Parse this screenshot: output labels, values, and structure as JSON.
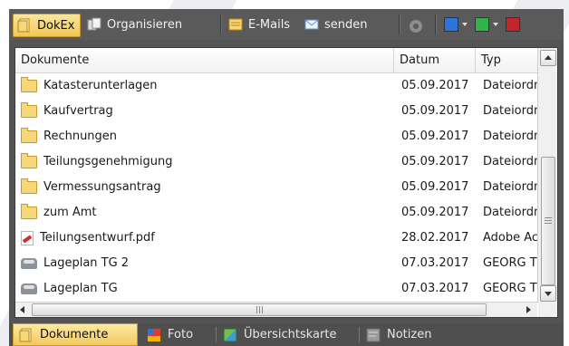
{
  "toolbar": {
    "dokex_label": "DokEx",
    "organisieren_label": "Organisieren",
    "emails_label": "E-Mails",
    "senden_label": "senden",
    "colors": {
      "blue": "#2b74d8",
      "green": "#34b24a",
      "red": "#c0262d"
    }
  },
  "list": {
    "columns": {
      "name": "Dokumente",
      "date": "Datum",
      "type": "Typ"
    },
    "rows": [
      {
        "icon": "folder-icon",
        "name": "Katasterunterlagen",
        "date": "05.09.2017",
        "type": "Dateiordner"
      },
      {
        "icon": "folder-icon",
        "name": "Kaufvertrag",
        "date": "05.09.2017",
        "type": "Dateiordner"
      },
      {
        "icon": "folder-icon",
        "name": "Rechnungen",
        "date": "05.09.2017",
        "type": "Dateiordner"
      },
      {
        "icon": "folder-icon",
        "name": "Teilungsgenehmigung",
        "date": "05.09.2017",
        "type": "Dateiordner"
      },
      {
        "icon": "folder-icon",
        "name": "Vermessungsantrag",
        "date": "05.09.2017",
        "type": "Dateiordner"
      },
      {
        "icon": "folder-icon",
        "name": "zum Amt",
        "date": "05.09.2017",
        "type": "Dateiordner"
      },
      {
        "icon": "pdf-icon",
        "name": "Teilungsentwurf.pdf",
        "date": "28.02.2017",
        "type": "Adobe Acrobat"
      },
      {
        "icon": "car-icon",
        "name": "Lageplan TG 2",
        "date": "07.03.2017",
        "type": "GEORG TG"
      },
      {
        "icon": "car-icon",
        "name": "Lageplan TG",
        "date": "07.03.2017",
        "type": "GEORG TG"
      }
    ]
  },
  "tabs": [
    {
      "label": "Dokumente",
      "icon": "document-icon",
      "active": true
    },
    {
      "label": "Foto",
      "icon": "photo-icon",
      "active": false
    },
    {
      "label": "Übersichtskarte",
      "icon": "map-icon",
      "active": false
    },
    {
      "label": "Notizen",
      "icon": "notes-icon",
      "active": false
    }
  ]
}
